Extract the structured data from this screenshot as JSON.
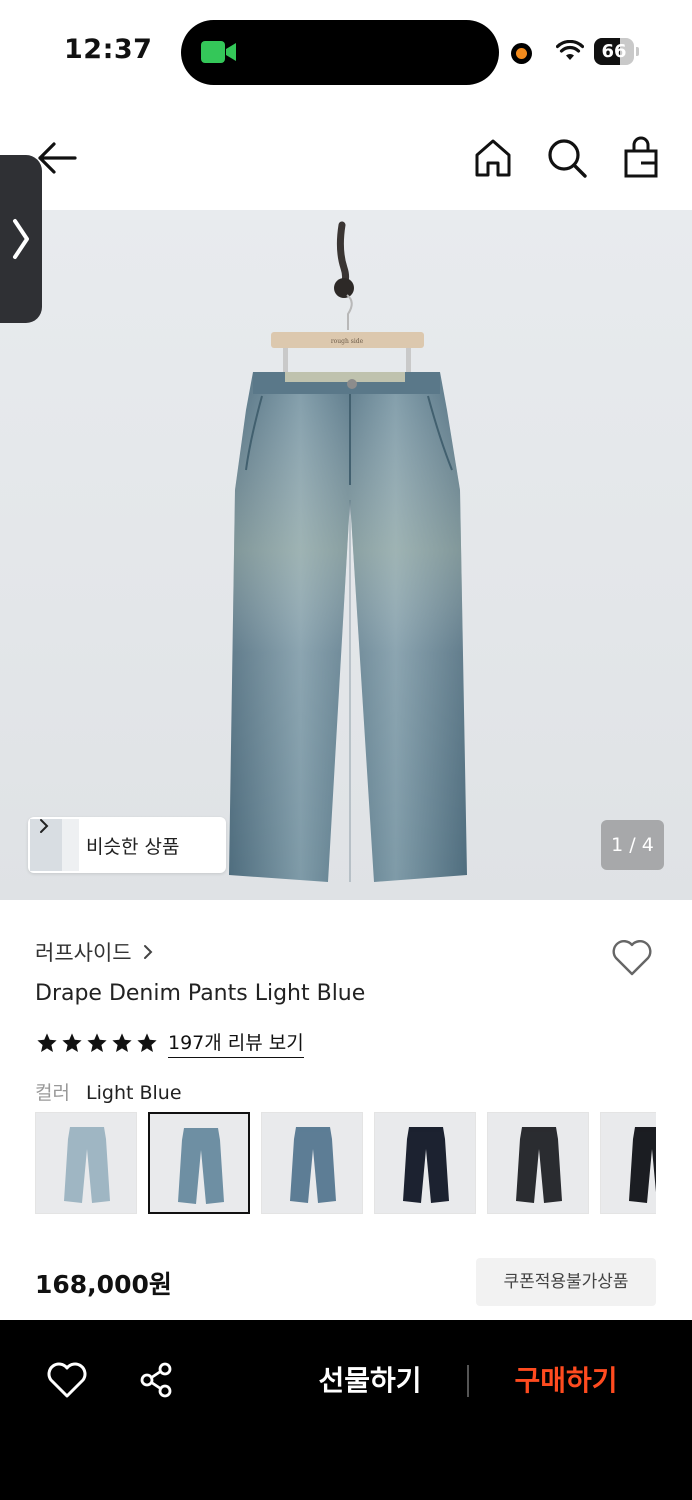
{
  "status_bar": {
    "time": "12:37",
    "battery": "66",
    "battery_level": 0.66,
    "camera_color": "#34c759",
    "recording_dot_color": "#f28a1c"
  },
  "nav": {
    "back_icon": "arrow-left-icon",
    "home_icon": "home-icon",
    "search_icon": "search-icon",
    "bag_icon": "shopping-bag-icon"
  },
  "gallery": {
    "similar_label": "비슷한 상품",
    "page_indicator": "1 / 4",
    "hanger_brand": "rough side"
  },
  "product": {
    "brand": "러프사이드",
    "name": "Drape Denim Pants Light Blue",
    "rating_stars": 5,
    "review_link": "197개 리뷰 보기",
    "color_label": "컬러",
    "color_value": "Light Blue",
    "price": "168,000원",
    "coupon_badge": "쿠폰적용불가상품"
  },
  "swatches": [
    {
      "color": "#9fb6c3",
      "selected": false
    },
    {
      "color": "#6e8fa3",
      "selected": true
    },
    {
      "color": "#5d7d95",
      "selected": false
    },
    {
      "color": "#1c2230",
      "selected": false
    },
    {
      "color": "#2a2c30",
      "selected": false
    },
    {
      "color": "#1b1d22",
      "selected": false
    }
  ],
  "bottom_bar": {
    "gift_label": "선물하기",
    "buy_label": "구매하기",
    "buy_color": "#ff4b1f"
  }
}
